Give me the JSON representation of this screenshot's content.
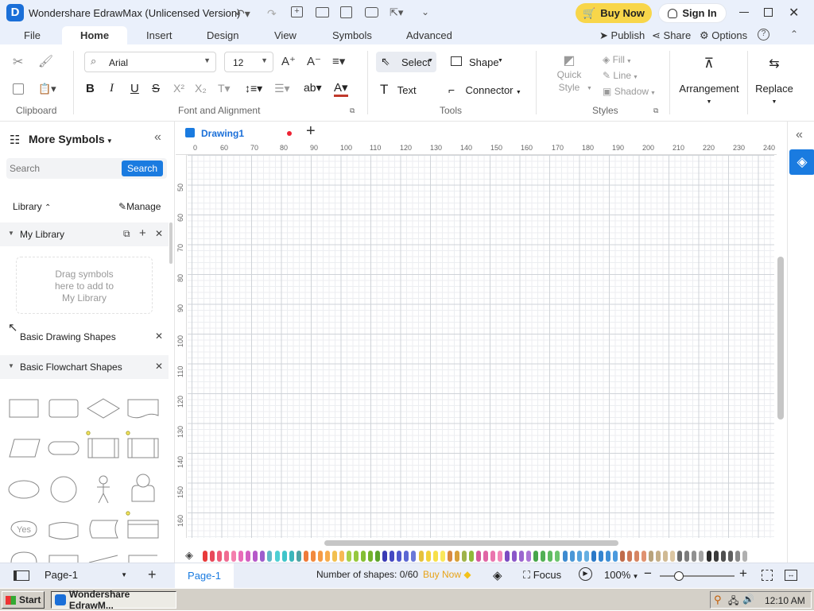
{
  "app": {
    "title": "Wondershare EdrawMax (Unlicensed Version)",
    "buy_now": "Buy Now",
    "sign_in": "Sign In"
  },
  "menu": {
    "tabs": [
      "File",
      "Home",
      "Insert",
      "Design",
      "View",
      "Symbols",
      "Advanced"
    ],
    "active": "Home",
    "publish": "Publish",
    "share": "Share",
    "options": "Options"
  },
  "ribbon": {
    "clipboard_label": "Clipboard",
    "font_name": "Arial",
    "font_size": "12",
    "font_group_label": "Font and Alignment",
    "select": "Select",
    "shape": "Shape",
    "text": "Text",
    "connector": "Connector",
    "tools_label": "Tools",
    "quick_style": "Quick\nStyle",
    "fill": "Fill",
    "line": "Line",
    "shadow": "Shadow",
    "styles_label": "Styles",
    "arrangement": "Arrangement",
    "replace": "Replace"
  },
  "left_panel": {
    "title": "More Symbols",
    "search_placeholder": "Search",
    "search_button": "Search",
    "library_label": "Library",
    "manage": "Manage",
    "my_library": "My Library",
    "drop_hint": "Drag symbols\nhere to add to\nMy Library",
    "basic_drawing": "Basic Drawing Shapes",
    "basic_flowchart": "Basic Flowchart Shapes",
    "yes_shape": "Yes"
  },
  "canvas": {
    "doc_tab": "Drawing1",
    "ruler_h": [
      "0",
      "60",
      "70",
      "80",
      "90",
      "100",
      "110",
      "120",
      "130",
      "140",
      "150",
      "160",
      "170",
      "180",
      "190",
      "200",
      "210",
      "220",
      "230",
      "240"
    ],
    "ruler_v": [
      "50",
      "60",
      "70",
      "80",
      "90",
      "100",
      "110",
      "120",
      "130",
      "140",
      "150",
      "160"
    ]
  },
  "status": {
    "page_selector": "Page-1",
    "page_tab": "Page-1",
    "shape_count": "Number of shapes: 0/60",
    "buy_now": "Buy Now",
    "focus": "Focus",
    "zoom": "100%"
  },
  "taskbar": {
    "start": "Start",
    "window": "Wondershare EdrawM...",
    "time": "12:10 AM"
  },
  "colors": {
    "accent": "#1a7be0",
    "buy": "#f8d64a",
    "palette": [
      "#e83a3a",
      "#e8485a",
      "#ee5b78",
      "#f06c92",
      "#f47fae",
      "#e86bb8",
      "#d35fc2",
      "#b658c9",
      "#9d5ccd",
      "#5fb8c7",
      "#4ecfd4",
      "#3fc4c9",
      "#3bb6bb",
      "#4ca3a5",
      "#ef7a3a",
      "#f28a3e",
      "#f59a44",
      "#f7ab4c",
      "#f2c04f",
      "#f7b955",
      "#a8d04a",
      "#96c83e",
      "#84bf34",
      "#74b32b",
      "#5da42a",
      "#3a3bb5",
      "#4448c2",
      "#5058cc",
      "#5c68d3",
      "#6a78d8",
      "#e6c13b",
      "#f2d23c",
      "#f7e04a",
      "#fae85c",
      "#d98a3f",
      "#d8a03a",
      "#9fb34a",
      "#8fb83a",
      "#d55a9c",
      "#e066a5",
      "#ea75ae",
      "#f286b8",
      "#7a4bc1",
      "#8b58c9",
      "#9b66cf",
      "#ab75d6",
      "#47a54a",
      "#52b055",
      "#5ebb60",
      "#6cc46d",
      "#3e8bd0",
      "#4a97d7",
      "#57a3dd",
      "#65afe2",
      "#2b79c8",
      "#3484d0",
      "#3f8fd6",
      "#4b9ade",
      "#c06b4a",
      "#cc7857",
      "#d68563",
      "#e09270",
      "#b8a27a",
      "#c4ae87",
      "#d0ba94",
      "#dcc6a1",
      "#6b6b6b",
      "#7d7d7d",
      "#909090",
      "#a3a3a3",
      "#2a2a2a",
      "#3c3c3c",
      "#4f4f4f",
      "#5f5f5f",
      "#8a8a8a",
      "#b0b0b0"
    ]
  }
}
